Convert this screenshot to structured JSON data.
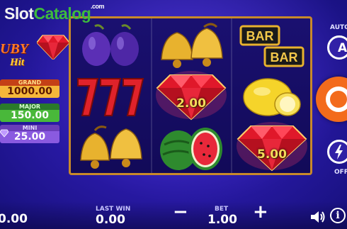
{
  "watermark": {
    "part1": "Slot",
    "part2": "Catalog",
    "part3": ".com"
  },
  "logo": {
    "title": "UBY",
    "subtitle": "Hit"
  },
  "jackpots": {
    "grand": {
      "label": "GRAND",
      "value": "1000.00"
    },
    "major": {
      "label": "MAJOR",
      "value": "150.00"
    },
    "mini": {
      "label": "MINI",
      "value": "25.00"
    }
  },
  "reels": {
    "symbols": [
      [
        "plum-icon",
        "seven-icon",
        "bell-icon"
      ],
      [
        "bell-icon",
        "diamond-icon",
        "watermelon-icon"
      ],
      [
        "bar-icon",
        "lemon-icon",
        "diamond-icon"
      ]
    ],
    "values": {
      "r1c1": "2.00",
      "r2c2": "5.00"
    },
    "bar_texts": [
      "BAR",
      "BAR"
    ]
  },
  "controls": {
    "auto_label": "AUTO",
    "auto_icon_text": "A",
    "off_label": "OFF",
    "minus_label": "−",
    "plus_label": "+",
    "info_label": "i"
  },
  "bottom": {
    "balance": "0.00",
    "last_win_label": "LAST WIN",
    "last_win_value": "0.00",
    "bet_label": "BET",
    "bet_value": "1.00"
  },
  "colors": {
    "accent": "#f36b1c",
    "frame": "#c8892a",
    "background": "#2a1aa8"
  }
}
